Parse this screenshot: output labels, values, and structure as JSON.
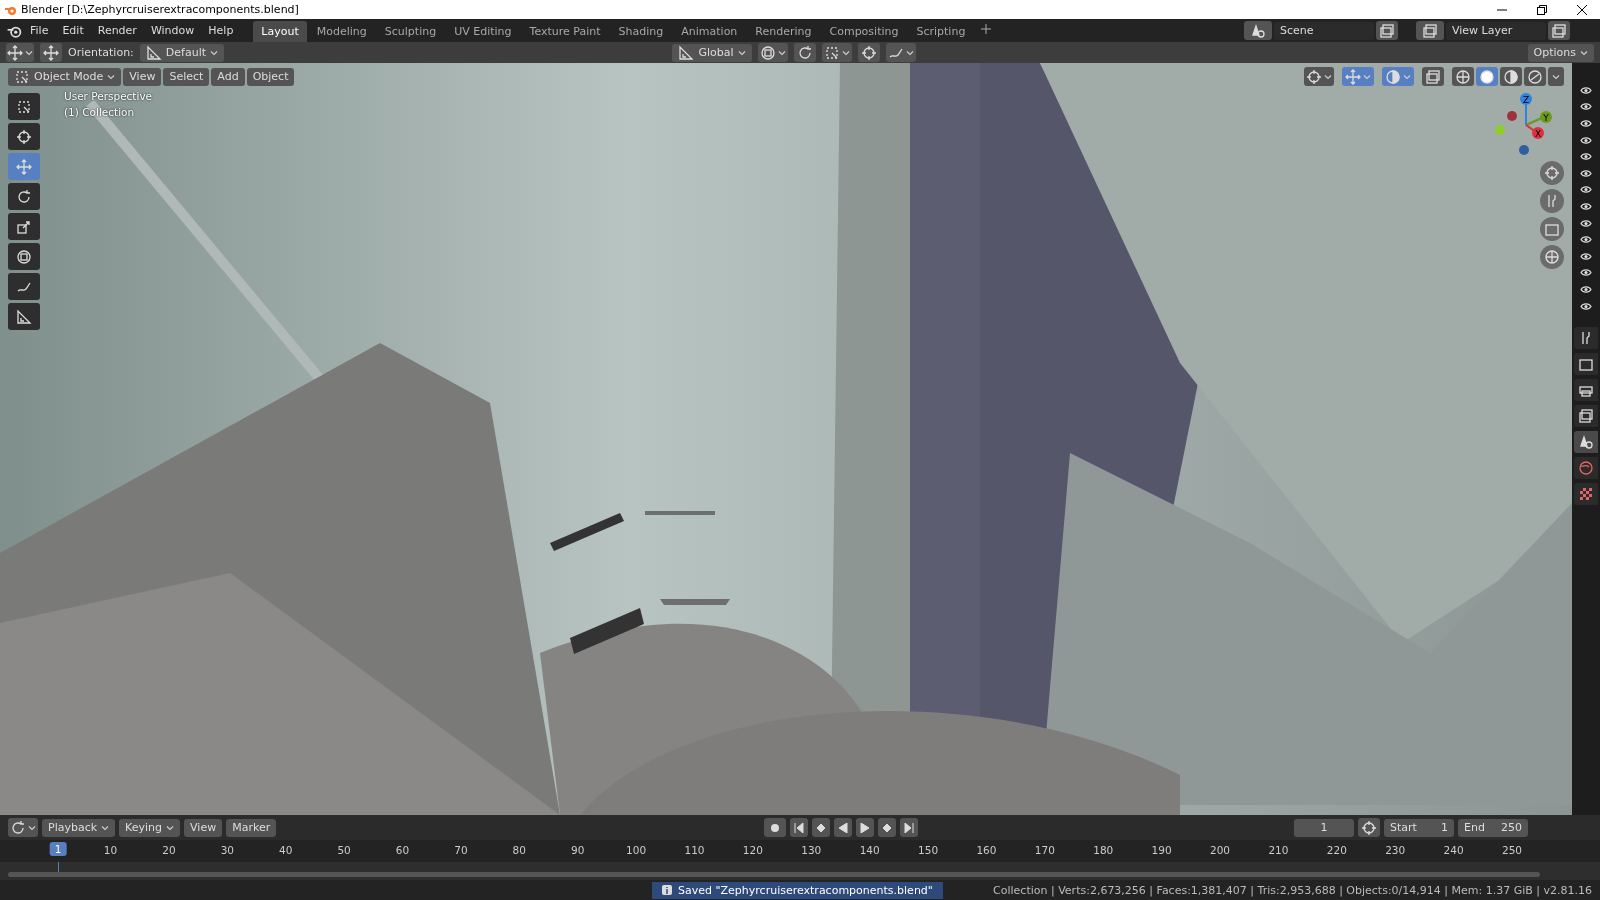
{
  "window": {
    "title": "Blender [D:\\Zephyrcruiserextracomponents.blend]"
  },
  "menu": [
    "File",
    "Edit",
    "Render",
    "Window",
    "Help"
  ],
  "workspaces": [
    {
      "label": "Layout",
      "selected": true
    },
    {
      "label": "Modeling",
      "selected": false
    },
    {
      "label": "Sculpting",
      "selected": false
    },
    {
      "label": "UV Editing",
      "selected": false
    },
    {
      "label": "Texture Paint",
      "selected": false
    },
    {
      "label": "Shading",
      "selected": false
    },
    {
      "label": "Animation",
      "selected": false
    },
    {
      "label": "Rendering",
      "selected": false
    },
    {
      "label": "Compositing",
      "selected": false
    },
    {
      "label": "Scripting",
      "selected": false
    }
  ],
  "scene": "Scene",
  "view_layer": "View Layer",
  "header": {
    "orientation_label": "Orientation:",
    "orientation": "Default",
    "transform": "Global",
    "options": "Options"
  },
  "viewport_header": {
    "mode": "Object Mode",
    "menus": [
      "View",
      "Select",
      "Add",
      "Object"
    ]
  },
  "viewport": {
    "overlay_lines": [
      "User Perspective",
      "(1) Collection"
    ],
    "axes": [
      "Z",
      "Y",
      "X"
    ]
  },
  "tools": [
    {
      "kind": "select",
      "selected": false
    },
    {
      "kind": "cursor",
      "selected": false
    },
    {
      "kind": "move",
      "selected": true
    },
    {
      "kind": "rotate",
      "selected": false
    },
    {
      "kind": "scale",
      "selected": false
    },
    {
      "kind": "transform",
      "selected": false
    },
    {
      "kind": "annotate",
      "selected": false
    },
    {
      "kind": "measure",
      "selected": false
    }
  ],
  "shading_modes": [
    {
      "kind": "wire",
      "selected": false
    },
    {
      "kind": "solid",
      "selected": true
    },
    {
      "kind": "material",
      "selected": false
    },
    {
      "kind": "rendered",
      "selected": false
    }
  ],
  "properties_tabs": [
    {
      "kind": "tool",
      "selected": false
    },
    {
      "kind": "render",
      "selected": false
    },
    {
      "kind": "output",
      "selected": false
    },
    {
      "kind": "view-layer",
      "selected": false
    },
    {
      "kind": "scene",
      "selected": true
    },
    {
      "kind": "world",
      "selected": false
    },
    {
      "kind": "texture",
      "selected": false
    }
  ],
  "timeline": {
    "menus": [
      "Playback",
      "Keying",
      "View",
      "Marker"
    ],
    "current_frame": "1",
    "start_label": "Start",
    "start": "1",
    "end_label": "End",
    "end": "250",
    "playhead": "1",
    "ruler": [
      "10",
      "20",
      "30",
      "40",
      "50",
      "60",
      "70",
      "80",
      "90",
      "100",
      "110",
      "120",
      "130",
      "140",
      "150",
      "160",
      "170",
      "180",
      "190",
      "200",
      "210",
      "220",
      "230",
      "240",
      "250"
    ]
  },
  "status": {
    "message": "Saved \"Zephyrcruiserextracomponents.blend\"",
    "stats": "Collection | Verts:2,673,256 | Faces:1,381,407 | Tris:2,953,688 | Objects:0/14,914 | Mem: 1.37 GiB | v2.81.16"
  }
}
